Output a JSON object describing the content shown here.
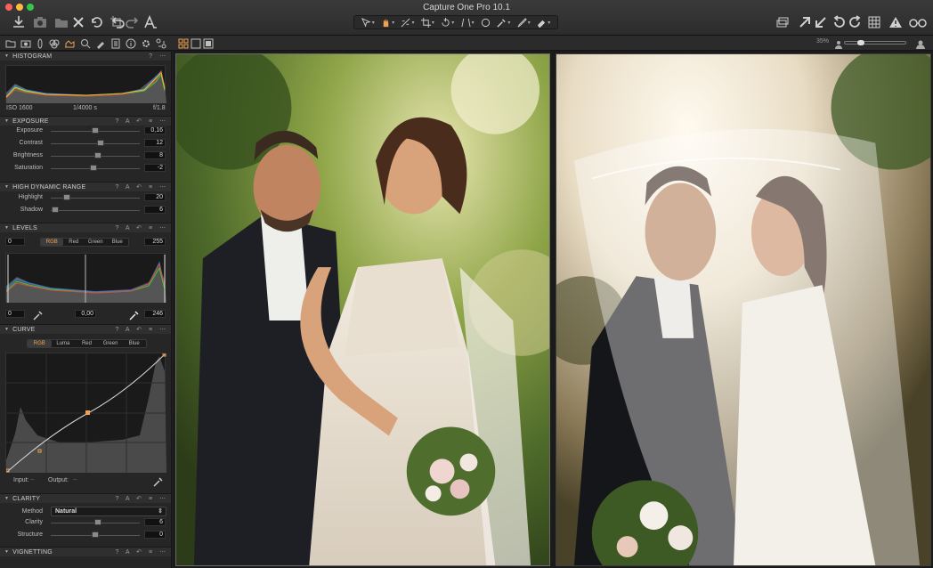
{
  "window": {
    "title": "Capture One Pro 10.1"
  },
  "viewer": {
    "zoom": "35%"
  },
  "colors": {
    "accent": "#f0a050",
    "panel": "#262626",
    "close": "#fc605c",
    "minimize": "#fdbc40",
    "maximize": "#34c84a"
  },
  "toolbar": {
    "left_icons": [
      "import-icon",
      "camera-icon",
      "folder-icon",
      "delete-icon",
      "undo-history-icon",
      "crop-icon",
      "undo-icon",
      "redo-icon",
      "text-style-icon"
    ],
    "cursor_tools": [
      "select-icon",
      "pan-icon",
      "straighten-icon",
      "crop-tool-icon",
      "rotate-icon",
      "keystone-icon",
      "circle-mask-icon",
      "picker-icon",
      "brush-icon",
      "eraser-icon"
    ],
    "right_icons": [
      "layers-icon",
      "export-icon",
      "import-arrow-icon",
      "rotate-left-icon",
      "rotate-right-icon",
      "grid-icon",
      "warning-icon",
      "glasses-icon"
    ]
  },
  "tool_tabs": [
    "library-icon",
    "capture-icon",
    "lens-icon",
    "color-icon",
    "exposure-icon",
    "details-icon",
    "local-adjust-icon",
    "metadata-icon",
    "info-icon",
    "settings-icon",
    "batch-icon"
  ],
  "histogram": {
    "title": "HISTOGRAM",
    "iso": "ISO 1600",
    "shutter": "1/4000 s",
    "aperture": "f/1.8"
  },
  "exposure": {
    "title": "EXPOSURE",
    "rows": [
      {
        "label": "Exposure",
        "value": "0,16",
        "level": 0.5
      },
      {
        "label": "Contrast",
        "value": "12",
        "level": 0.56
      },
      {
        "label": "Brightness",
        "value": "8",
        "level": 0.53
      },
      {
        "label": "Saturation",
        "value": "-2",
        "level": 0.48
      }
    ]
  },
  "hdr": {
    "title": "HIGH DYNAMIC RANGE",
    "rows": [
      {
        "label": "Highlight",
        "value": "20",
        "level": 0.18
      },
      {
        "label": "Shadow",
        "value": "6",
        "level": 0.05
      }
    ]
  },
  "levels": {
    "title": "LEVELS",
    "min": "0",
    "max": "255",
    "channels": [
      "RGB",
      "Red",
      "Green",
      "Blue"
    ],
    "output_low": "0",
    "midpoint": "0,00",
    "output_high": "246"
  },
  "curve": {
    "title": "CURVE",
    "channels": [
      "RGB",
      "Luma",
      "Red",
      "Green",
      "Blue"
    ],
    "input_label": "Input:",
    "input_value": "--",
    "output_label": "Output:",
    "output_value": "--"
  },
  "clarity": {
    "title": "CLARITY",
    "method_label": "Method",
    "method_value": "Natural",
    "rows": [
      {
        "label": "Clarity",
        "value": "6",
        "level": 0.53
      },
      {
        "label": "Structure",
        "value": "0",
        "level": 0.5
      }
    ]
  },
  "vignetting": {
    "title": "VIGNETTING"
  },
  "section_icons": "? A ↶ ≡ ⋯"
}
